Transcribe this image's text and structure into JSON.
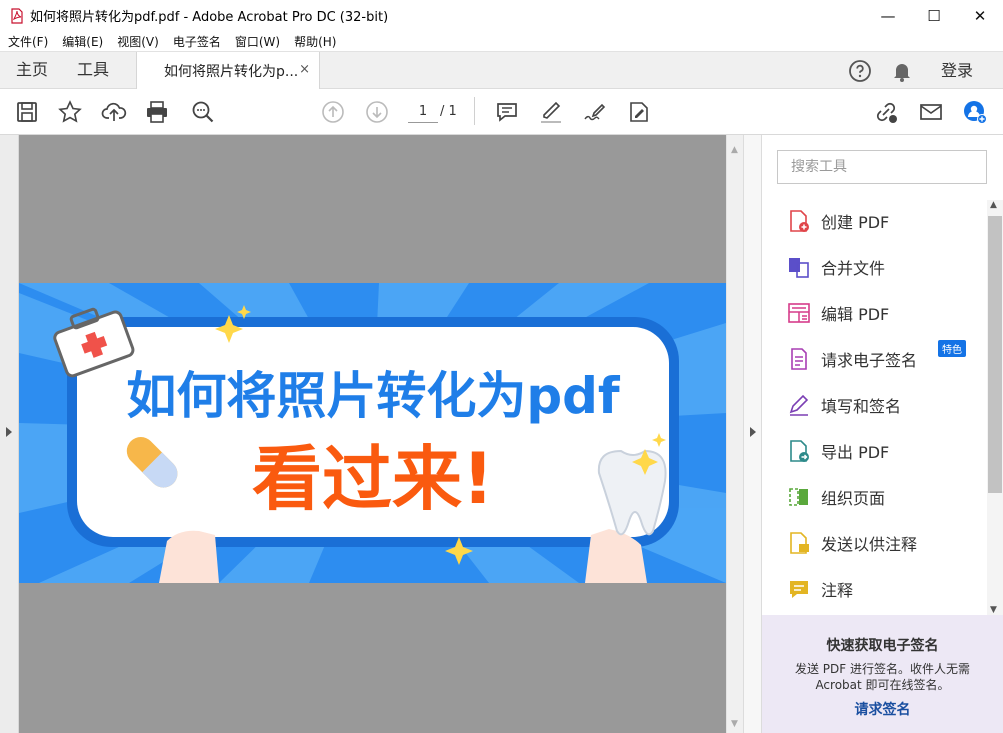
{
  "window": {
    "title": "如何将照片转化为pdf.pdf - Adobe Acrobat Pro DC (32-bit)",
    "minimize": "—",
    "maximize": "☐",
    "close": "✕"
  },
  "menu": [
    "文件(F)",
    "编辑(E)",
    "视图(V)",
    "电子签名",
    "窗口(W)",
    "帮助(H)"
  ],
  "tabs": {
    "home": "主页",
    "tools": "工具",
    "document": "如何将照片转化为p...",
    "close": "×"
  },
  "header_right": {
    "help_icon": "help-circle-icon",
    "bell_icon": "bell-icon",
    "login": "登录"
  },
  "toolbar": {
    "page_current": "1",
    "page_total": "/ 1"
  },
  "banner": {
    "headline": "如何将照片转化为pdf",
    "sub": "看过来!"
  },
  "tools_panel": {
    "search_placeholder": "搜索工具",
    "items": [
      {
        "label": "创建 PDF",
        "color": "#e0454a"
      },
      {
        "label": "合并文件",
        "color": "#5b4fc9"
      },
      {
        "label": "编辑 PDF",
        "color": "#d63c8a"
      },
      {
        "label": "请求电子签名",
        "color": "#a83fb4",
        "badge": "特色"
      },
      {
        "label": "填写和签名",
        "color": "#7b3fb4"
      },
      {
        "label": "导出 PDF",
        "color": "#2d8a8a"
      },
      {
        "label": "组织页面",
        "color": "#5aa83c"
      },
      {
        "label": "发送以供注释",
        "color": "#e3b523"
      },
      {
        "label": "注释",
        "color": "#e3b523"
      }
    ],
    "promo": {
      "title": "快速获取电子签名",
      "body": "发送 PDF 进行签名。收件人无需 Acrobat 即可在线签名。",
      "link": "请求签名"
    }
  },
  "colors": {
    "accent": "#1473e6",
    "banner_blue": "#2c8ff0",
    "headline_blue": "#1f7ee8",
    "sub_orange": "#fa5a0f"
  }
}
